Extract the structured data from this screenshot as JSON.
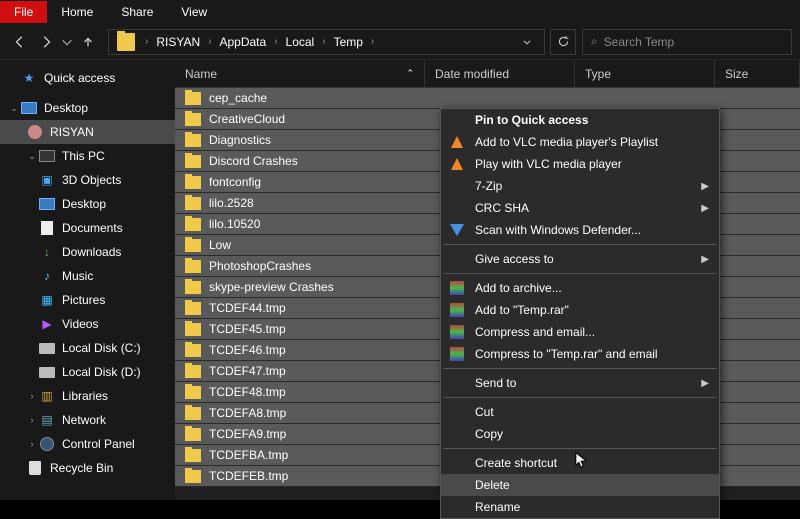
{
  "ribbon": {
    "tabs": [
      "File",
      "Home",
      "Share",
      "View"
    ]
  },
  "breadcrumb": {
    "items": [
      "RISYAN",
      "AppData",
      "Local",
      "Temp"
    ]
  },
  "search": {
    "placeholder": "Search Temp"
  },
  "columns": {
    "name": "Name",
    "date": "Date modified",
    "type": "Type",
    "size": "Size"
  },
  "sidebar": {
    "quick_access": "Quick access",
    "desktop": "Desktop",
    "risyan": "RISYAN",
    "this_pc": "This PC",
    "objects3d": "3D Objects",
    "desktop2": "Desktop",
    "documents": "Documents",
    "downloads": "Downloads",
    "music": "Music",
    "pictures": "Pictures",
    "videos": "Videos",
    "disk_c": "Local Disk (C:)",
    "disk_d": "Local Disk (D:)",
    "libraries": "Libraries",
    "network": "Network",
    "control_panel": "Control Panel",
    "recycle_bin": "Recycle Bin"
  },
  "files": [
    "cep_cache",
    "CreativeCloud",
    "Diagnostics",
    "Discord Crashes",
    "fontconfig",
    "lilo.2528",
    "lilo.10520",
    "Low",
    "PhotoshopCrashes",
    "skype-preview Crashes",
    "TCDEF44.tmp",
    "TCDEF45.tmp",
    "TCDEF46.tmp",
    "TCDEF47.tmp",
    "TCDEF48.tmp",
    "TCDEFA8.tmp",
    "TCDEFA9.tmp",
    "TCDEFBA.tmp",
    "TCDEFEB.tmp"
  ],
  "context_menu": {
    "pin": "Pin to Quick access",
    "vlc_playlist": "Add to VLC media player's Playlist",
    "vlc_play": "Play with VLC media player",
    "sevenzip": "7-Zip",
    "crc": "CRC SHA",
    "defender": "Scan with Windows Defender...",
    "give_access": "Give access to",
    "add_archive": "Add to archive...",
    "add_temp_rar": "Add to \"Temp.rar\"",
    "compress_email": "Compress and email...",
    "compress_temp_email": "Compress to \"Temp.rar\" and email",
    "send_to": "Send to",
    "cut": "Cut",
    "copy": "Copy",
    "create_shortcut": "Create shortcut",
    "delete": "Delete",
    "rename": "Rename"
  }
}
